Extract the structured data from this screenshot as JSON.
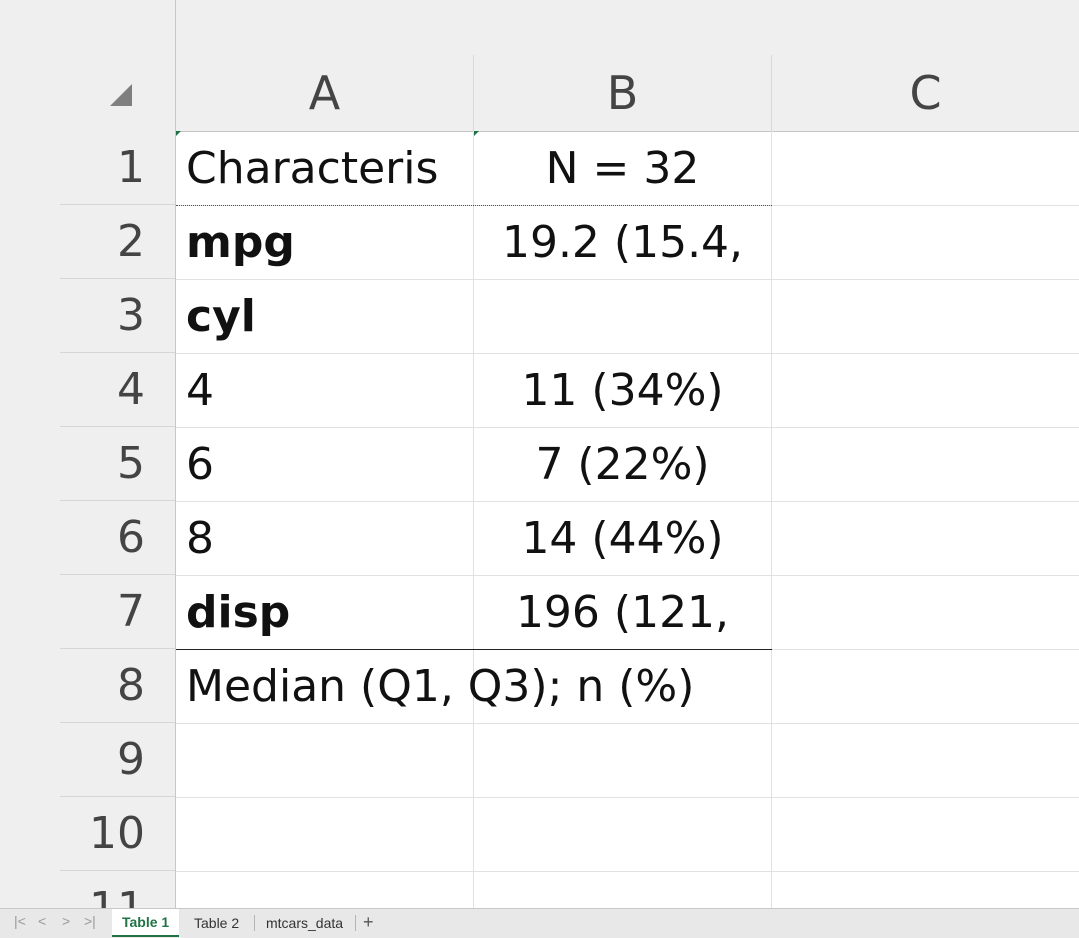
{
  "columns": [
    "A",
    "B",
    "C"
  ],
  "rows": [
    "1",
    "2",
    "3",
    "4",
    "5",
    "6",
    "7",
    "8",
    "9",
    "10",
    "11"
  ],
  "cells": {
    "r1": {
      "a": "Characteris",
      "b": "N = 32"
    },
    "r2": {
      "a": "mpg",
      "b": "19.2 (15.4,"
    },
    "r3": {
      "a": "cyl",
      "b": ""
    },
    "r4": {
      "a": "4",
      "b": "11 (34%)"
    },
    "r5": {
      "a": "6",
      "b": "7 (22%)"
    },
    "r6": {
      "a": "8",
      "b": "14 (44%)"
    },
    "r7": {
      "a": "disp",
      "b": "196 (121,"
    },
    "r8": {
      "a": "Median (Q1, Q3); n (%)"
    }
  },
  "tabs": {
    "nav": [
      "|<",
      "<",
      ">",
      ">|"
    ],
    "sheets": [
      "Table 1",
      "Table 2",
      "mtcars_data"
    ],
    "active": "Table 1",
    "add": "+"
  },
  "colors": {
    "active_tab": "#217346",
    "header_bg": "#efefef"
  }
}
